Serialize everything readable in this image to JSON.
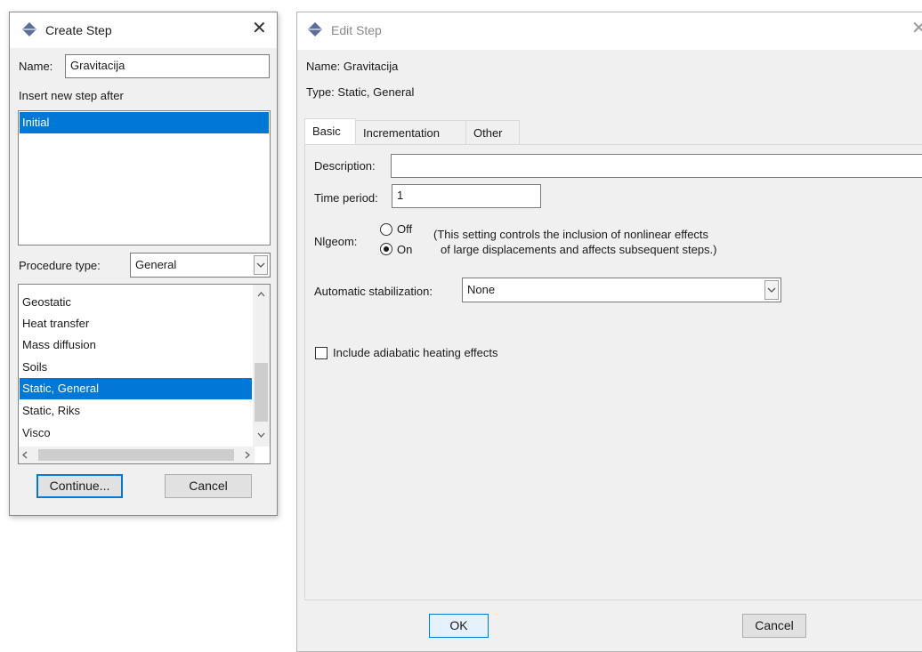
{
  "create_step": {
    "title": "Create Step",
    "close_glyph": "✕",
    "name_label": "Name:",
    "name_value": "Gravitacija",
    "insert_after_label": "Insert new step after",
    "steps": [
      "Initial"
    ],
    "procedure_type_label": "Procedure type:",
    "procedure_type_value": "General",
    "procedures": [
      "Geostatic",
      "Heat transfer",
      "Mass diffusion",
      "Soils",
      "Static, General",
      "Static, Riks",
      "Visco"
    ],
    "selected_procedure": "Static, General",
    "continue_label": "Continue...",
    "cancel_label": "Cancel"
  },
  "edit_step": {
    "title": "Edit Step",
    "close_glyph": "✕",
    "name_line": "Name:  Gravitacija",
    "type_line": "Type:  Static, General",
    "tabs": [
      "Basic",
      "Incrementation",
      "Other"
    ],
    "active_tab": "Basic",
    "description_label": "Description:",
    "description_value": "",
    "time_period_label": "Time period:",
    "time_period_value": "1",
    "nlgeom_label": "Nlgeom:",
    "nlgeom_options": [
      "Off",
      "On"
    ],
    "nlgeom_selected": "On",
    "nlgeom_note_line1": "(This setting controls the inclusion of nonlinear effects",
    "nlgeom_note_line2": "of large displacements and affects subsequent steps.)",
    "auto_stab_label": "Automatic stabilization:",
    "auto_stab_value": "None",
    "adiabatic_label": "Include adiabatic heating effects",
    "adiabatic_checked": false,
    "ok_label": "OK",
    "cancel_label": "Cancel"
  },
  "colors": {
    "selection": "#0078d7",
    "dialog_bg": "#f0f0f0",
    "icon_fill": "#5b6f9a"
  },
  "icons": {
    "title_icon": "step-arrows-icon",
    "dropdown": "chevron-down-icon"
  }
}
